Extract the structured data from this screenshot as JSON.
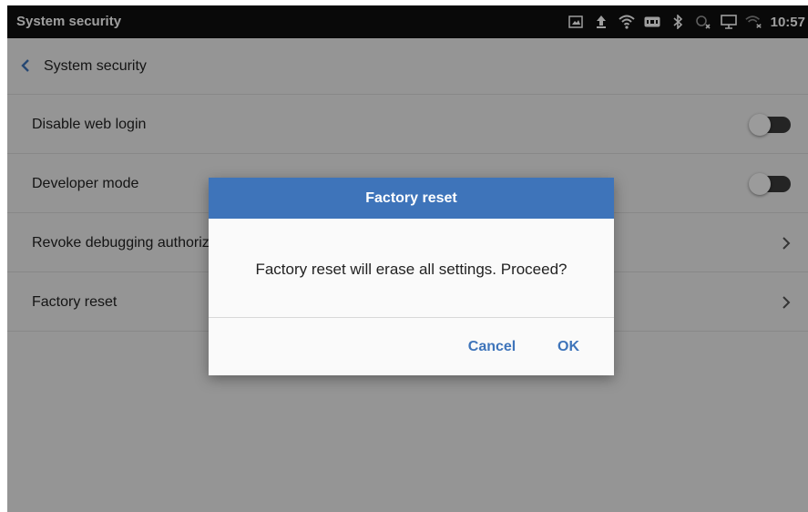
{
  "status_bar": {
    "title": "System security",
    "time": "10:57",
    "icons": [
      "screenshot-icon",
      "upload-icon",
      "wifi-hotspot-icon",
      "ftp-icon",
      "bluetooth-icon",
      "no-ethernet-icon",
      "cast-icon",
      "wifi-off-icon"
    ]
  },
  "action_bar": {
    "title": "System security"
  },
  "settings": {
    "items": [
      {
        "label": "Disable web login",
        "control": "toggle",
        "state": "off"
      },
      {
        "label": "Developer mode",
        "control": "toggle",
        "state": "off"
      },
      {
        "label": "Revoke debugging authorizations",
        "control": "chevron"
      },
      {
        "label": "Factory reset",
        "control": "chevron"
      }
    ]
  },
  "dialog": {
    "title": "Factory reset",
    "message": "Factory reset will erase all settings. Proceed?",
    "cancel_label": "Cancel",
    "ok_label": "OK"
  },
  "colors": {
    "accent": "#3e74ba",
    "status_bar_bg": "#0f0f0f",
    "toggle_track_off": "#3a3a3a"
  }
}
